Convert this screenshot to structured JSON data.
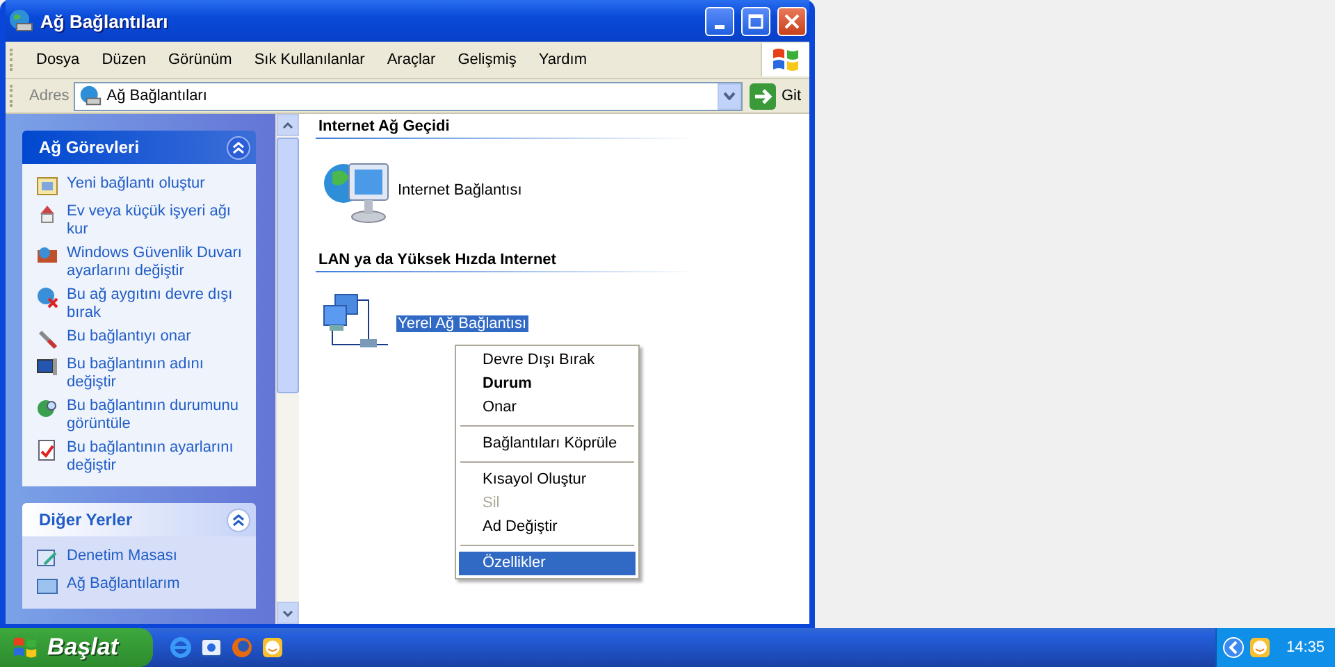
{
  "window": {
    "title": "Ağ Bağlantıları"
  },
  "menu_bar": [
    "Dosya",
    "Düzen",
    "Görünüm",
    "Sık Kullanılanlar",
    "Araçlar",
    "Gelişmiş",
    "Yardım"
  ],
  "address_bar": {
    "label": "Adres",
    "value": "Ağ Bağlantıları",
    "go_button": "Git"
  },
  "sidebar": {
    "panels": [
      {
        "title": "Ağ Görevleri",
        "expanded": true,
        "items": [
          "Yeni bağlantı oluştur",
          "Ev veya küçük işyeri ağı kur",
          "Windows Güvenlik Duvarı ayarlarını değiştir",
          "Bu ağ aygıtını devre dışı bırak",
          "Bu bağlantıyı onar",
          "Bu bağlantının adını değiştir",
          "Bu bağlantının durumunu görüntüle",
          "Bu bağlantının ayarlarını değiştir"
        ]
      },
      {
        "title": "Diğer Yerler",
        "expanded": true,
        "items": [
          "Denetim Masası",
          "Ağ Bağlantılarım"
        ]
      }
    ]
  },
  "groups": [
    {
      "title": "Internet Ağ Geçidi",
      "items": [
        {
          "label": "Internet Bağlantısı",
          "kind": "gateway",
          "selected": false
        }
      ]
    },
    {
      "title": "LAN ya da Yüksek Hızda Internet",
      "items": [
        {
          "label": "Yerel Ağ Bağlantısı",
          "kind": "lan",
          "selected": true
        }
      ]
    }
  ],
  "context_menu": [
    {
      "kind": "item",
      "label": "Devre Dışı Bırak",
      "bold": false,
      "disabled": false,
      "selected": false
    },
    {
      "kind": "item",
      "label": "Durum",
      "bold": true,
      "disabled": false,
      "selected": false
    },
    {
      "kind": "item",
      "label": "Onar",
      "bold": false,
      "disabled": false,
      "selected": false
    },
    {
      "kind": "separator"
    },
    {
      "kind": "item",
      "label": "Bağlantıları Köprüle",
      "bold": false,
      "disabled": false,
      "selected": false
    },
    {
      "kind": "separator"
    },
    {
      "kind": "item",
      "label": "Kısayol Oluştur",
      "bold": false,
      "disabled": false,
      "selected": false
    },
    {
      "kind": "item",
      "label": "Sil",
      "bold": false,
      "disabled": true,
      "selected": false
    },
    {
      "kind": "item",
      "label": "Ad Değiştir",
      "bold": false,
      "disabled": false,
      "selected": false
    },
    {
      "kind": "separator"
    },
    {
      "kind": "item",
      "label": "Özellikler",
      "bold": false,
      "disabled": false,
      "selected": true
    }
  ],
  "taskbar": {
    "start": "Başlat",
    "clock": "14:35"
  }
}
